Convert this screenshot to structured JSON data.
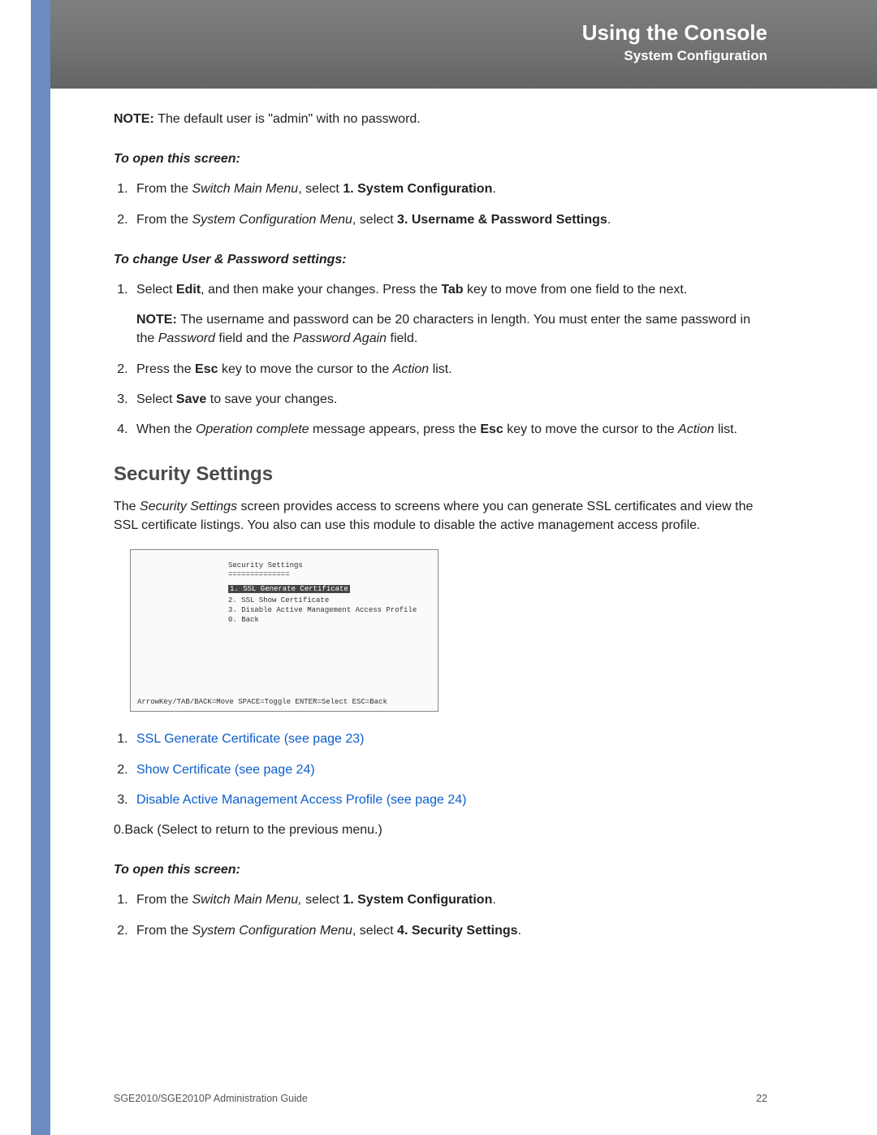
{
  "header": {
    "title": "Using the Console",
    "subtitle": "System Configuration"
  },
  "note_default_user_prefix": "NOTE: ",
  "note_default_user_body": "The default user is \"admin\" with no password.",
  "subhead_open1": "To open this screen:",
  "open1_steps": {
    "s1_a": "From the ",
    "s1_b": "Switch Main Menu",
    "s1_c": ", select ",
    "s1_d": "1. System Configuration",
    "s1_e": ".",
    "s2_a": "From the ",
    "s2_b": "System Configuration Menu",
    "s2_c": ", select ",
    "s2_d": "3. Username & Password Settings",
    "s2_e": "."
  },
  "subhead_change": "To change User & Password settings:",
  "change_steps": {
    "s1_a": "Select ",
    "s1_b": "Edit",
    "s1_c": ", and then make your changes. Press the ",
    "s1_d": "Tab",
    "s1_e": " key to move from one field to the next.",
    "note_prefix": "NOTE: ",
    "note_body_a": "The username and password can be 20 characters in length. You must enter the same password in the ",
    "note_body_b": "Password",
    "note_body_c": " field and the ",
    "note_body_d": "Password Again",
    "note_body_e": " field.",
    "s2_a": "Press the ",
    "s2_b": "Esc",
    "s2_c": " key to move the cursor to the ",
    "s2_d": "Action",
    "s2_e": " list.",
    "s3_a": "Select ",
    "s3_b": "Save",
    "s3_c": " to save your changes.",
    "s4_a": "When the ",
    "s4_b": "Operation complete",
    "s4_c": " message appears, press the ",
    "s4_d": "Esc",
    "s4_e": " key to move the cursor to the ",
    "s4_f": "Action",
    "s4_g": " list."
  },
  "section_title": "Security Settings",
  "section_intro_a": "The ",
  "section_intro_b": "Security Settings",
  "section_intro_c": " screen provides access to screens where you can generate SSL certificates and view the SSL certificate listings. You also can use this module to disable the active management access profile.",
  "console": {
    "title": "Security Settings",
    "rule": "==============",
    "items": [
      "1. SSL Generate Certificate",
      "2. SSL Show Certificate",
      "3. Disable Active Management Access Profile",
      "0. Back"
    ],
    "footer": "ArrowKey/TAB/BACK=Move  SPACE=Toggle  ENTER=Select  ESC=Back"
  },
  "links": {
    "l1": "SSL Generate Certificate (see page 23)",
    "l2": "Show Certificate (see page 24)",
    "l3": "Disable Active Management Access Profile (see page 24)"
  },
  "back_line": "0.Back (Select to return to the previous menu.)",
  "subhead_open2": "To open this screen:",
  "open2_steps": {
    "s1_a": "From the ",
    "s1_b": "Switch Main Menu,",
    "s1_c": " select ",
    "s1_d": "1. System Configuration",
    "s1_e": ".",
    "s2_a": "From the ",
    "s2_b": "System Configuration Menu",
    "s2_c": ", select ",
    "s2_d": "4. Security Settings",
    "s2_e": "."
  },
  "footer": {
    "guide": "SGE2010/SGE2010P Administration Guide",
    "page": "22"
  }
}
